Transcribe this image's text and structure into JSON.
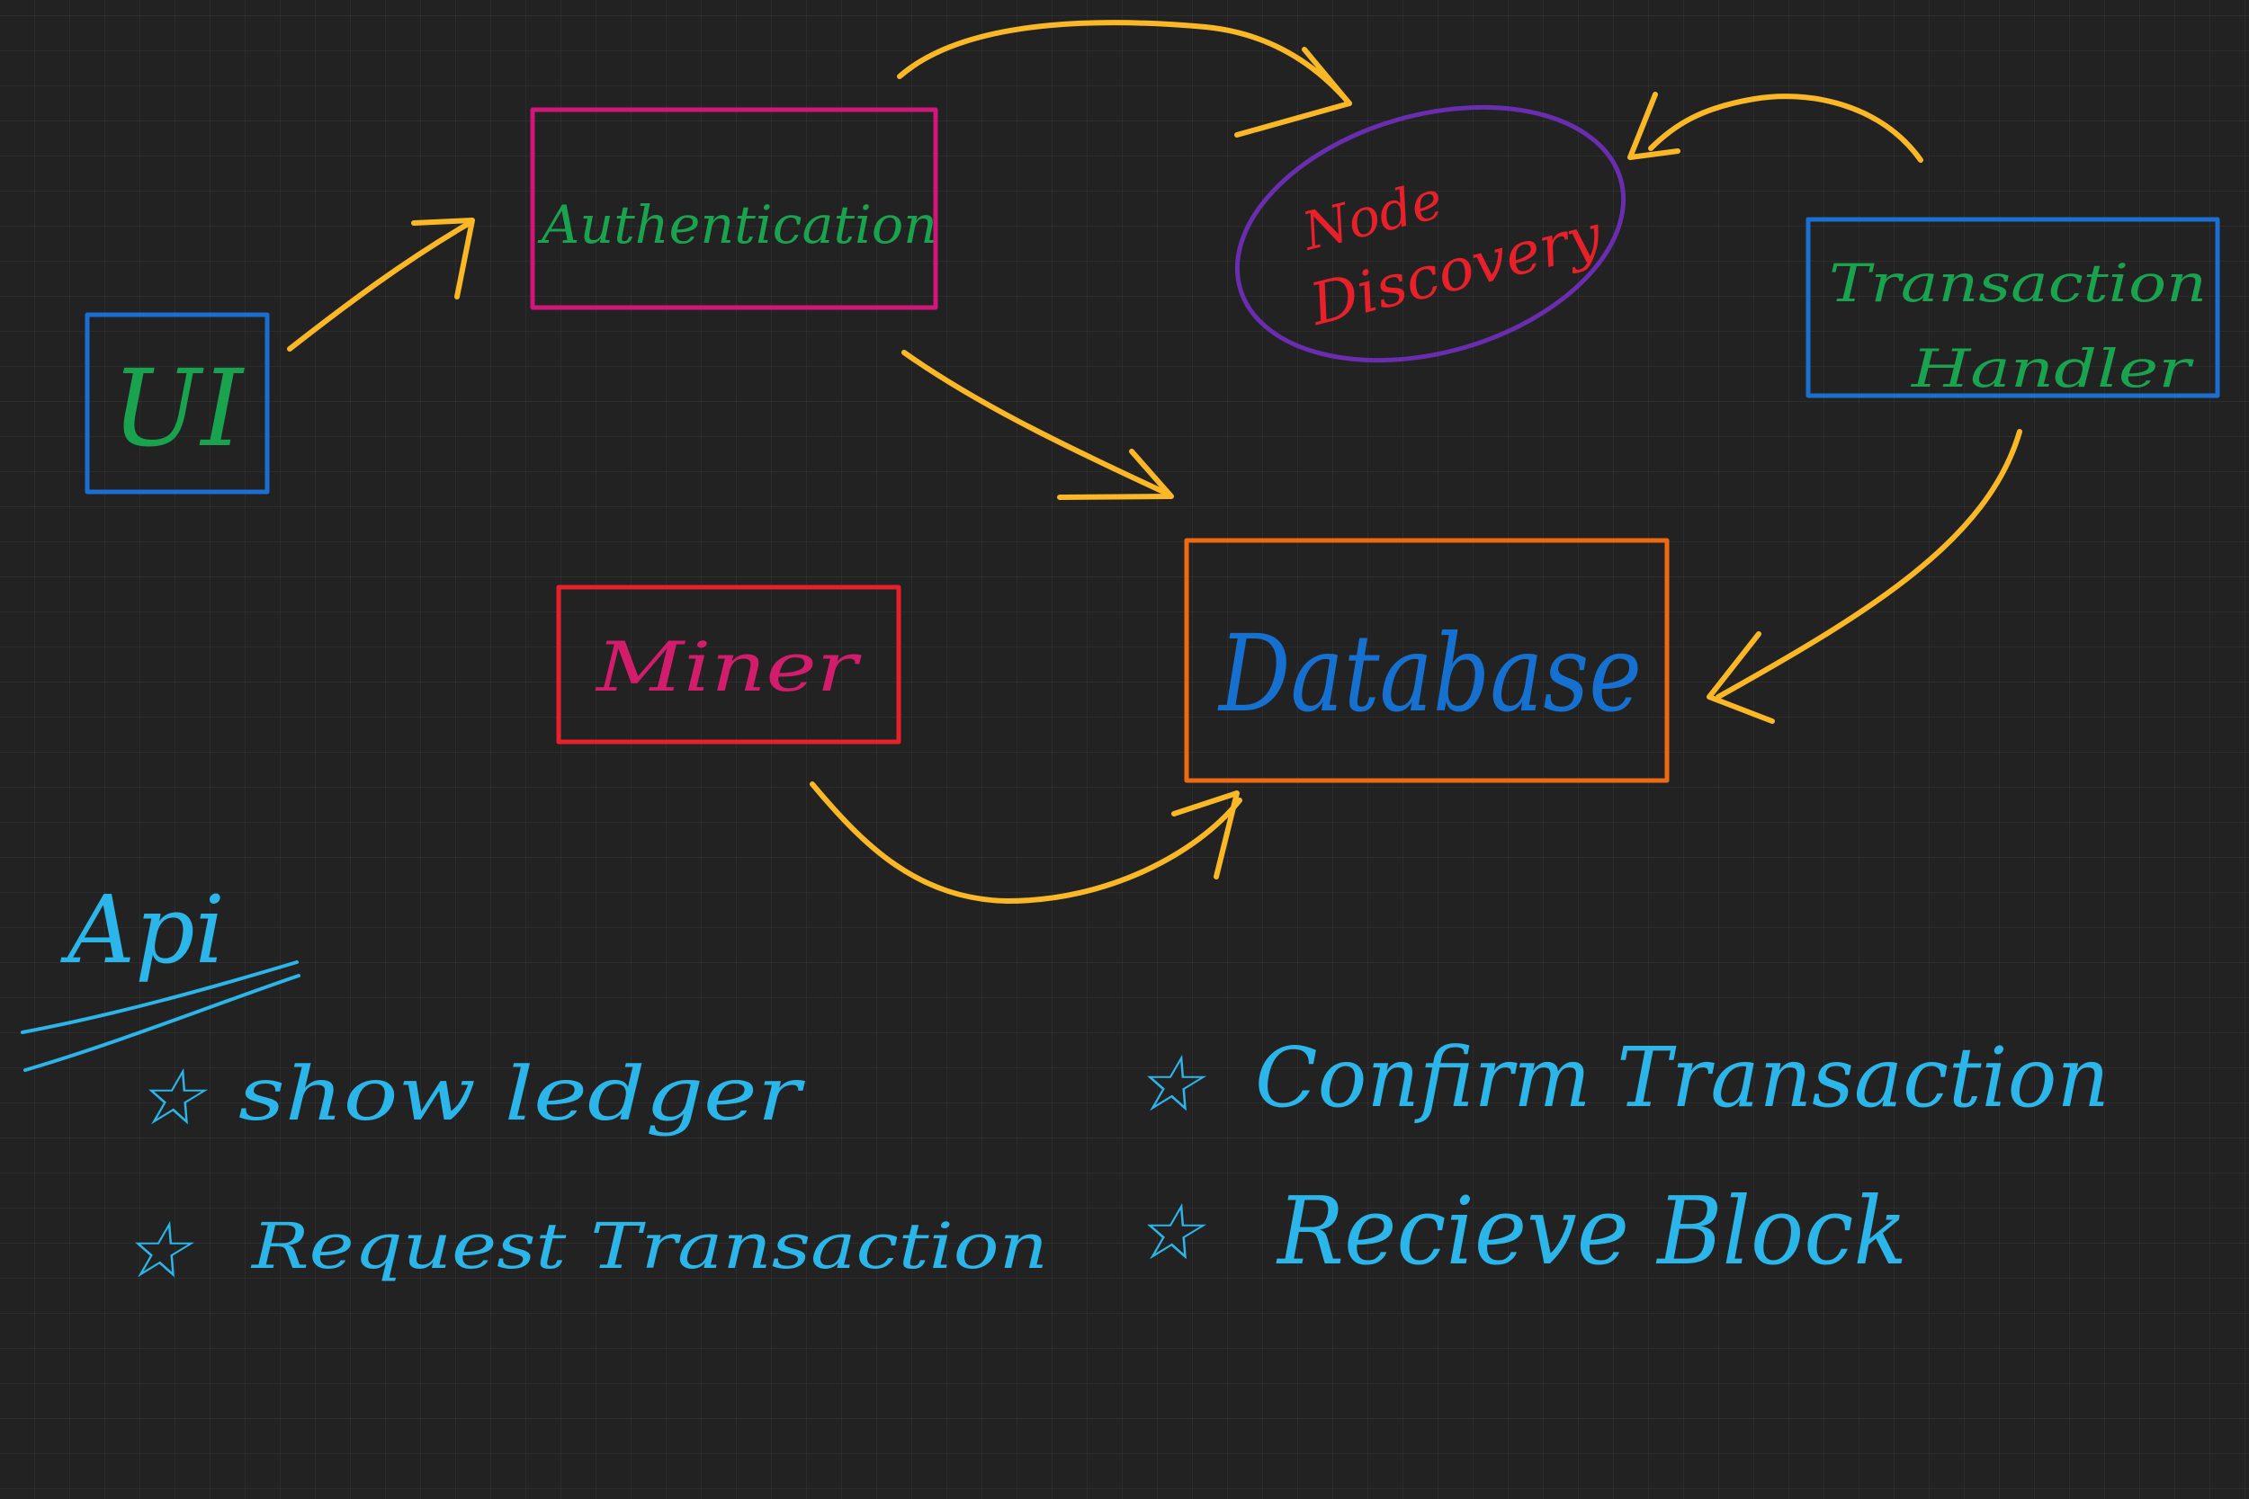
{
  "colors": {
    "background": "#222222",
    "arrow": "#FBB826",
    "api_text": "#2BB5E8",
    "label_green": "#19A34E",
    "label_red": "#E8202A",
    "label_magenta": "#D21D6C",
    "label_blue": "#1570D0"
  },
  "nodes": [
    {
      "id": "ui",
      "label": "UI",
      "shape": "rectangle",
      "border_color": "#1A6FD0",
      "text_color": "#19A34E"
    },
    {
      "id": "authentication",
      "label": "Authentication",
      "shape": "rectangle",
      "border_color": "#D0167A",
      "text_color": "#19A34E"
    },
    {
      "id": "node-discovery",
      "label_lines": [
        "Node",
        "Discovery"
      ],
      "shape": "ellipse",
      "border_color": "#6A2DB0",
      "text_color": "#E8202A"
    },
    {
      "id": "transaction-handler",
      "label_lines": [
        "Transaction",
        "Handler"
      ],
      "shape": "rectangle",
      "border_color": "#1A6FD0",
      "text_color": "#19A34E"
    },
    {
      "id": "miner",
      "label": "Miner",
      "shape": "rectangle",
      "border_color": "#E8202A",
      "text_color": "#D21D6C"
    },
    {
      "id": "database",
      "label": "Database",
      "shape": "rectangle",
      "border_color": "#EE6A12",
      "text_color": "#1570D0"
    }
  ],
  "edges": [
    {
      "from": "ui",
      "to": "authentication"
    },
    {
      "from": "authentication",
      "to": "node-discovery"
    },
    {
      "from": "authentication",
      "to": "database"
    },
    {
      "from": "transaction-handler",
      "to": "node-discovery"
    },
    {
      "from": "transaction-handler",
      "to": "database"
    },
    {
      "from": "miner",
      "to": "database"
    }
  ],
  "api": {
    "title": "Api",
    "items": [
      {
        "bullet": "☆",
        "label": "show ledger"
      },
      {
        "bullet": "☆",
        "label": "Confirm Transaction"
      },
      {
        "bullet": "☆",
        "label": "Request Transaction"
      },
      {
        "bullet": "☆",
        "label": "Recieve Block"
      }
    ]
  }
}
